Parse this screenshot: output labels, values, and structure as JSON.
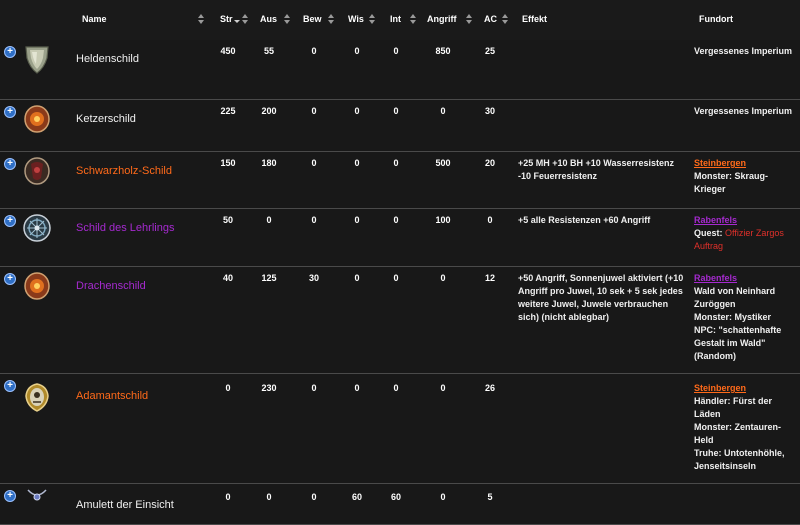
{
  "table": {
    "columns": {
      "name": "Name",
      "str": "Str",
      "aus": "Aus",
      "bew": "Bew",
      "wis": "Wis",
      "int": "Int",
      "angriff": "Angriff",
      "ac": "AC",
      "effekt": "Effekt",
      "fundort": "Fundort"
    },
    "expand_glyph": "+",
    "rows": [
      {
        "name": "Heldenschild",
        "rarity_color": "#f0f0f0",
        "icon": "hero-shield-icon",
        "str": "450",
        "aus": "55",
        "bew": "0",
        "wis": "0",
        "int": "0",
        "angriff": "850",
        "ac": "25",
        "effekt": "",
        "fundort": {
          "location": "Vergessenes Imperium"
        }
      },
      {
        "name": "Ketzerschild",
        "rarity_color": "#f0f0f0",
        "icon": "heretic-shield-icon",
        "str": "225",
        "aus": "200",
        "bew": "0",
        "wis": "0",
        "int": "0",
        "angriff": "0",
        "ac": "30",
        "effekt": "",
        "fundort": {
          "location": "Vergessenes Imperium"
        }
      },
      {
        "name": "Schwarzholz-Schild",
        "rarity_color": "#ff6a1a",
        "icon": "blackwood-shield-icon",
        "str": "150",
        "aus": "180",
        "bew": "0",
        "wis": "0",
        "int": "0",
        "angriff": "500",
        "ac": "20",
        "effekt": "+25 MH +10 BH +10 Wasserresistenz -10 Feuerresistenz",
        "fundort": {
          "location": "Steinbergen",
          "l1_label": "Monster:",
          "l1_value": "Skraug-Krieger"
        }
      },
      {
        "name": "Schild des Lehrlings",
        "rarity_color": "#a52acf",
        "icon": "apprentice-shield-icon",
        "str": "50",
        "aus": "0",
        "bew": "0",
        "wis": "0",
        "int": "0",
        "angriff": "100",
        "ac": "0",
        "effekt": "+5 alle Resistenzen +60 Angriff",
        "fundort": {
          "location": "Rabenfels",
          "l1_label": "Quest:",
          "l1_value": "Offizier Zargos Auftrag"
        }
      },
      {
        "name": "Drachenschild",
        "rarity_color": "#a52acf",
        "icon": "dragon-shield-icon",
        "str": "40",
        "aus": "125",
        "bew": "30",
        "wis": "0",
        "int": "0",
        "angriff": "0",
        "ac": "12",
        "effekt": "+50 Angriff, Sonnenjuwel aktiviert (+10 Angriff pro Juwel, 10 sek + 5 sek jedes weitere Juwel, Juwele verbrauchen sich) (nicht ablegbar)",
        "fundort": {
          "location": "Rabenfels",
          "sub": "Wald von Neinhard Zuröggen",
          "l1_label": "Monster:",
          "l1_value": "Mystiker",
          "l2_label": "NPC:",
          "l2_value": "\"schattenhafte Gestalt im Wald\" (Random)"
        }
      },
      {
        "name": "Adamantschild",
        "rarity_color": "#ff6a1a",
        "icon": "adamant-shield-icon",
        "str": "0",
        "aus": "230",
        "bew": "0",
        "wis": "0",
        "int": "0",
        "angriff": "0",
        "ac": "26",
        "effekt": "",
        "fundort": {
          "location": "Steinbergen",
          "l1_label": "Händler:",
          "l1_value": "Fürst der Läden",
          "l2_label": "Monster:",
          "l2_value": "Zentauren-Held",
          "l3_label": "Truhe:",
          "l3_value": "Untotenhöhle, Jenseitsinseln"
        }
      },
      {
        "name": "Amulett der Einsicht",
        "rarity_color": "#f0f0f0",
        "icon": "amulet-icon",
        "str": "0",
        "aus": "0",
        "bew": "0",
        "wis": "60",
        "int": "60",
        "angriff": "0",
        "ac": "5",
        "effekt": "",
        "fundort": {
          "location": ""
        }
      }
    ]
  }
}
